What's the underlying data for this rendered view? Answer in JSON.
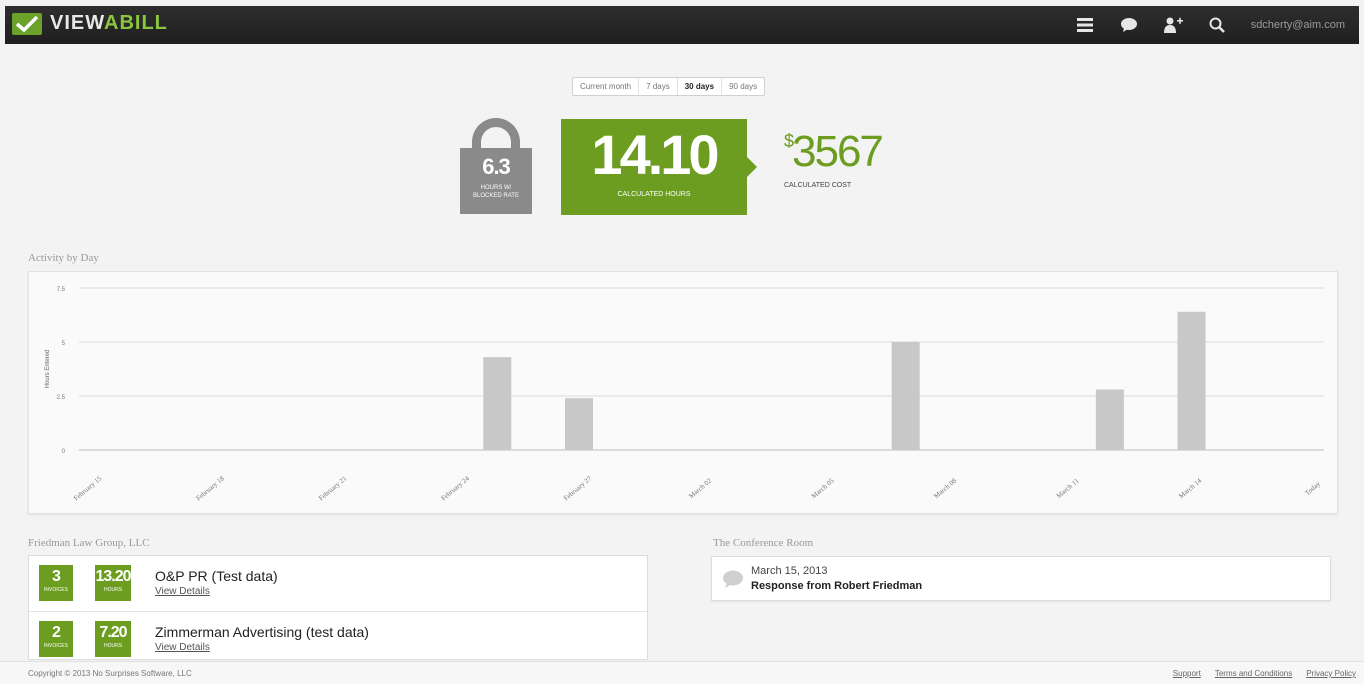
{
  "app": {
    "logo_text_a": "VIEW",
    "logo_text_b": "ABILL",
    "user_email": "sdcherty@aim.com"
  },
  "icons": {
    "menu": "menu-icon",
    "chat": "chat-icon",
    "add_user": "add-user-icon",
    "search": "search-icon"
  },
  "range_tabs": [
    {
      "label": "Current month",
      "active": false
    },
    {
      "label": "7 days",
      "active": false
    },
    {
      "label": "30 days",
      "active": true
    },
    {
      "label": "90 days",
      "active": false
    }
  ],
  "stats": {
    "blocked_hours": "6.3",
    "blocked_label_1": "HOURS W/",
    "blocked_label_2": "BLOCKED RATE",
    "calculated_hours": "14.10",
    "calculated_hours_label": "CALCULATED HOURS",
    "cost_symbol": "$",
    "cost_value": "3567",
    "cost_label": "CALCULATED COST"
  },
  "activity": {
    "title": "Activity by Day"
  },
  "chart_data": {
    "type": "bar",
    "title": "Activity by Day",
    "ylabel": "Hours Entered",
    "ylim": [
      0,
      7.5
    ],
    "y_ticks": [
      "0",
      "2.5",
      "5",
      "7.5"
    ],
    "x_labels": [
      "February 15",
      "February 18",
      "February 21",
      "February 24",
      "February 27",
      "March 02",
      "March 05",
      "March 08",
      "March 11",
      "March 14",
      "Today"
    ],
    "bars": [
      {
        "x": "February 25",
        "value": 4.3
      },
      {
        "x": "February 27",
        "value": 2.4
      },
      {
        "x": "March 07",
        "value": 5.0
      },
      {
        "x": "March 12",
        "value": 2.8
      },
      {
        "x": "March 14",
        "value": 6.4
      }
    ],
    "colors": {
      "bar": "#c8c8c8"
    }
  },
  "clients": {
    "title": "Friedman Law Group, LLC",
    "items": [
      {
        "invoices": "3",
        "invoices_label": "INVOICES",
        "hours": "13.20",
        "hours_label": "HOURS",
        "name": "O&P PR (Test data)",
        "link": "View Details"
      },
      {
        "invoices": "2",
        "invoices_label": "INVOICES",
        "hours": "7.20",
        "hours_label": "HOURS",
        "name": "Zimmerman Advertising (test data)",
        "link": "View Details"
      }
    ]
  },
  "conference": {
    "title": "The Conference Room",
    "date": "March 15, 2013",
    "message": "Response from Robert Friedman"
  },
  "footer": {
    "copyright": "Copyright © 2013 No Surprises Software, LLC",
    "links": [
      "Support",
      "Terms and Conditions",
      "Privacy Policy"
    ]
  },
  "colors": {
    "brand_green": "#6c9c20",
    "lock_gray": "#8a8a8a",
    "topbar": "#2a2a2a"
  }
}
